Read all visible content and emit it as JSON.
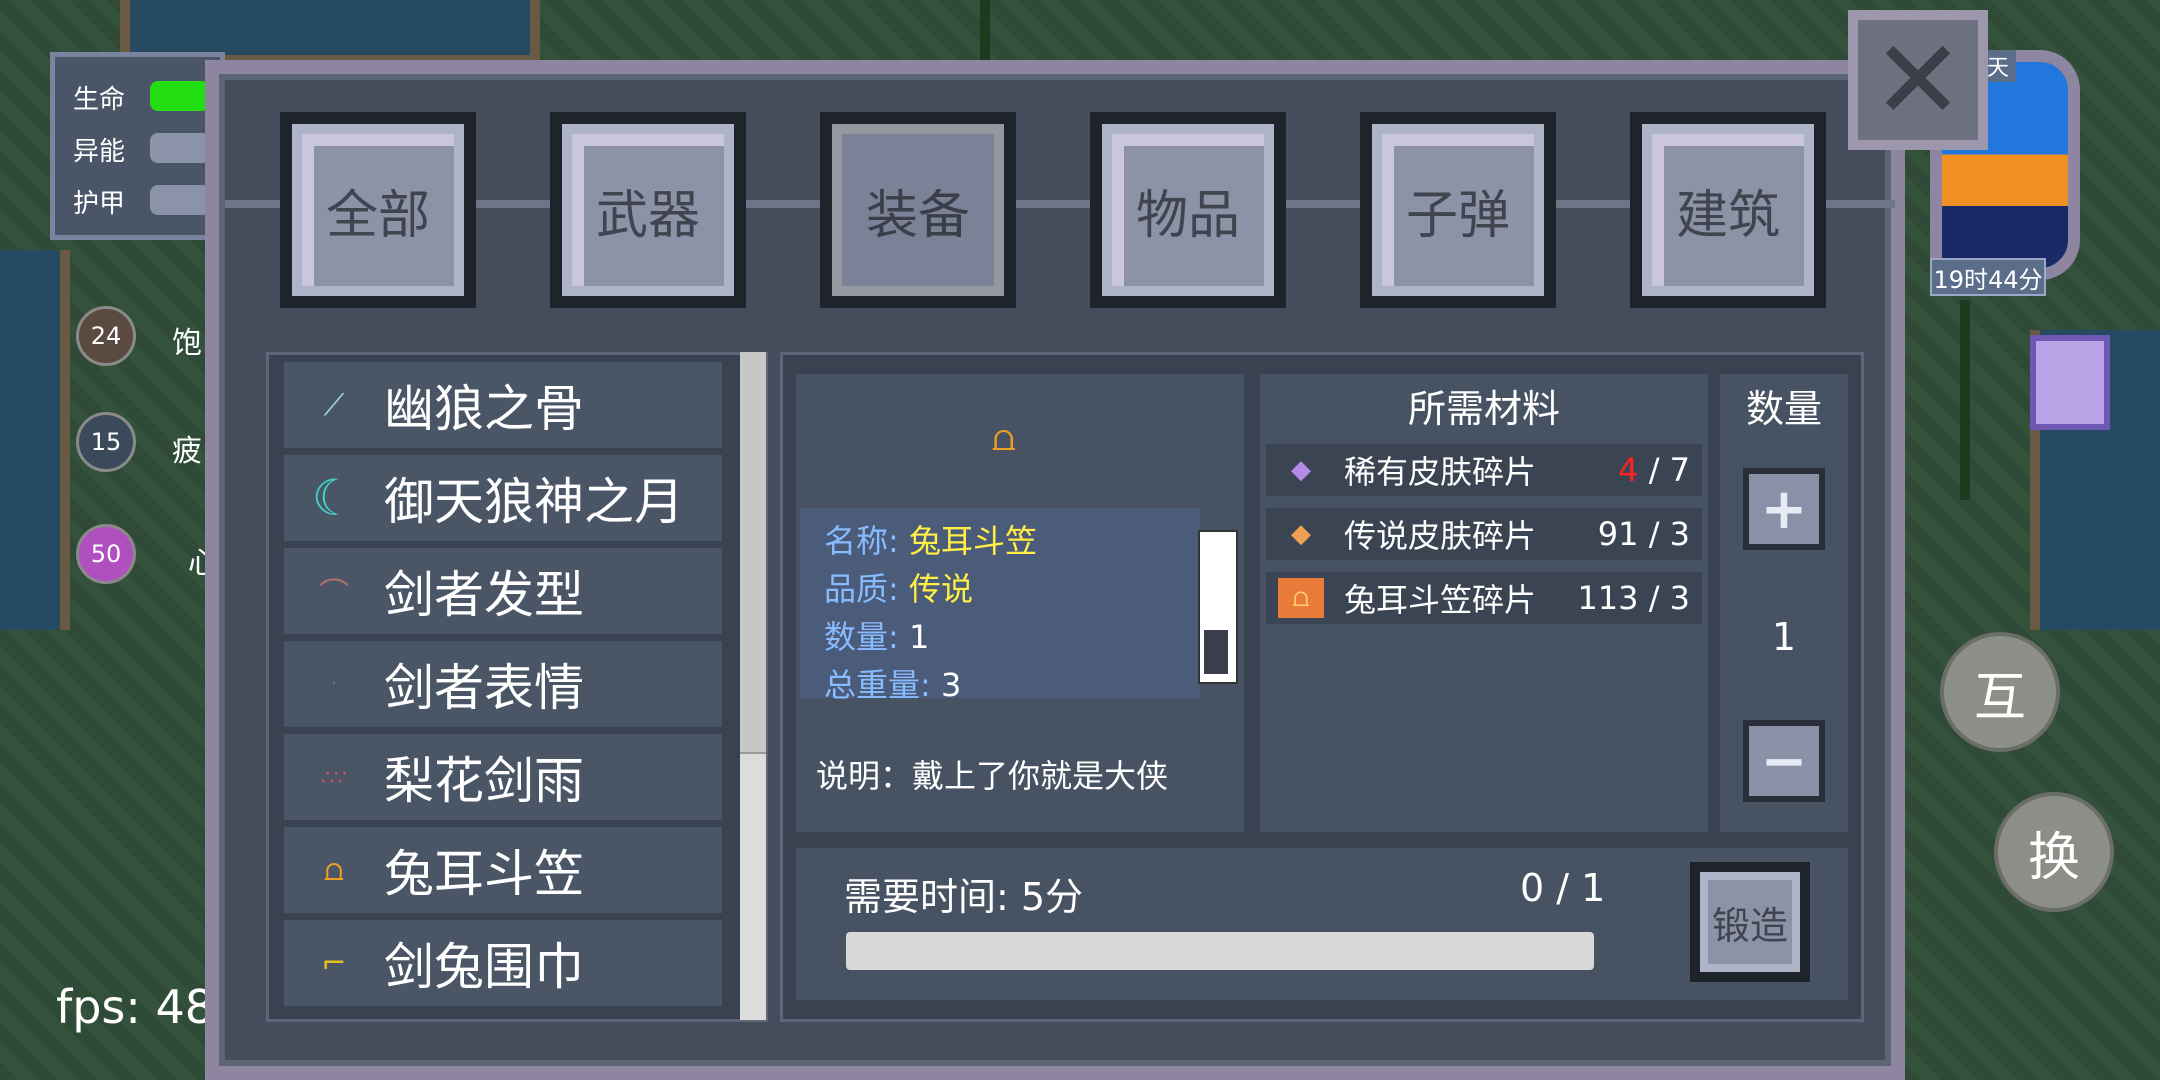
{
  "hud": {
    "hp_label": "生命",
    "energy_label": "异能",
    "armor_label": "护甲",
    "hp_color": "#22dd11"
  },
  "stats": [
    {
      "value": "24",
      "text": "饱"
    },
    {
      "value": "15",
      "text": "疲"
    },
    {
      "value": "50",
      "text": "心"
    }
  ],
  "fps": "fps: 48",
  "clock": {
    "time": "19时44分",
    "day_label": "天"
  },
  "buttons": {
    "interact": "互",
    "switch": "换"
  },
  "tabs": [
    "全部",
    "武器",
    "装备",
    "物品",
    "子弹",
    "建筑"
  ],
  "active_tab": "装备",
  "items": [
    {
      "name": "幽狼之骨",
      "icon": "bone-icon"
    },
    {
      "name": "御天狼神之月",
      "icon": "moon-icon"
    },
    {
      "name": "剑者发型",
      "icon": "hair-icon"
    },
    {
      "name": "剑者表情",
      "icon": "face-icon"
    },
    {
      "name": "梨花剑雨",
      "icon": "petal-icon"
    },
    {
      "name": "兔耳斗笠",
      "icon": "hat-icon"
    },
    {
      "name": "剑兔围巾",
      "icon": "scarf-icon"
    }
  ],
  "detail": {
    "name_key": "名称:",
    "name_val": "兔耳斗笠",
    "quality_key": "品质:",
    "quality_val": "传说",
    "count_key": "数量:",
    "count_val": "1",
    "weight_key": "总重量:",
    "weight_val": "3",
    "description": "说明：戴上了你就是大侠"
  },
  "materials": {
    "title": "所需材料",
    "rows": [
      {
        "name": "稀有皮肤碎片",
        "have": "4",
        "need": "/ 7",
        "icon": "purple-shard-icon",
        "have_color": "#ff2222"
      },
      {
        "name": "传说皮肤碎片",
        "have": "91",
        "need": "/ 3",
        "icon": "orange-shard-icon",
        "have_color": "#ffffff"
      },
      {
        "name": "兔耳斗笠碎片",
        "have": "113",
        "need": "/ 3",
        "icon": "hat-shard-icon",
        "have_color": "#ffffff"
      }
    ]
  },
  "quantity": {
    "title": "数量",
    "value": "1"
  },
  "craft": {
    "time_label": "需要时间:  5分",
    "progress_text": "0 / 1",
    "progress": 0,
    "forge_label": "锻造"
  }
}
